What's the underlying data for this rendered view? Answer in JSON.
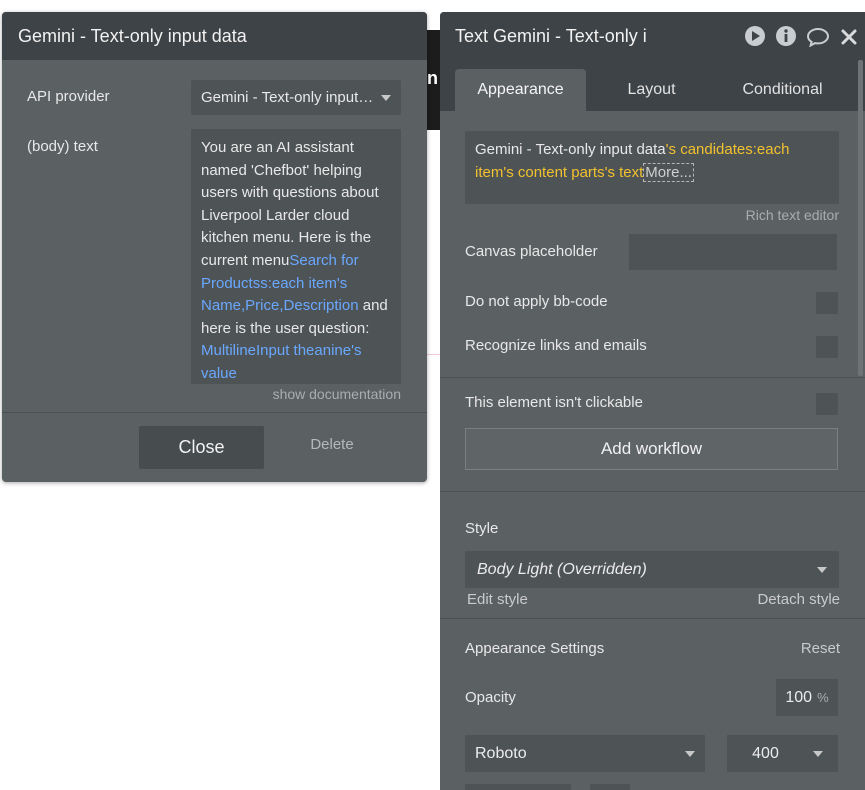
{
  "background": {
    "canvas_char": "n"
  },
  "left_popup": {
    "title": "Gemini - Text-only input data",
    "api_provider_label": "API provider",
    "api_provider_value": "Gemini - Text-only input data",
    "body_label": "(body) text",
    "body_text_1": "You are an AI assistant named 'Chefbot' helping users with questions about Liverpool Larder cloud kitchen menu. Here is the current menu",
    "body_dyn_1": "Search for Productss:each item's Name,Price,Description",
    "body_text_2": " and  here is the user question: ",
    "body_dyn_2": "MultilineInput theanine's value",
    "show_documentation": "show documentation",
    "close_label": "Close",
    "delete_label": "Delete"
  },
  "panel": {
    "title": "Text Gemini - Text-only i",
    "tabs": [
      {
        "label": "Appearance",
        "active": true
      },
      {
        "label": "Layout",
        "active": false
      },
      {
        "label": "Conditional",
        "active": false
      }
    ],
    "text_value_white": "Gemini - Text-only input data",
    "text_value_yellow": "'s candidates:each item's content parts's text",
    "more_label": "More...",
    "rich_text_editor": "Rich text editor",
    "canvas_placeholder_label": "Canvas placeholder",
    "do_not_apply_bbcode_label": "Do not apply bb-code",
    "recognize_links_label": "Recognize links and emails",
    "not_clickable_label": "This element isn't clickable",
    "add_workflow_label": "Add workflow",
    "style_label": "Style",
    "style_value": "Body Light (Overridden)",
    "edit_style_label": "Edit style",
    "detach_style_label": "Detach style",
    "appearance_settings_label": "Appearance Settings",
    "reset_label": "Reset",
    "opacity_label": "Opacity",
    "opacity_value": "100",
    "opacity_unit": "%",
    "font_value": "Roboto",
    "font_weight_value": "400"
  },
  "colors": {
    "panel_bg": "#5b6063",
    "header_bg": "#3e4347",
    "input_bg": "#4e5356",
    "dynamic_blue": "#6aa8ff",
    "dynamic_yellow": "#f2c12e"
  }
}
